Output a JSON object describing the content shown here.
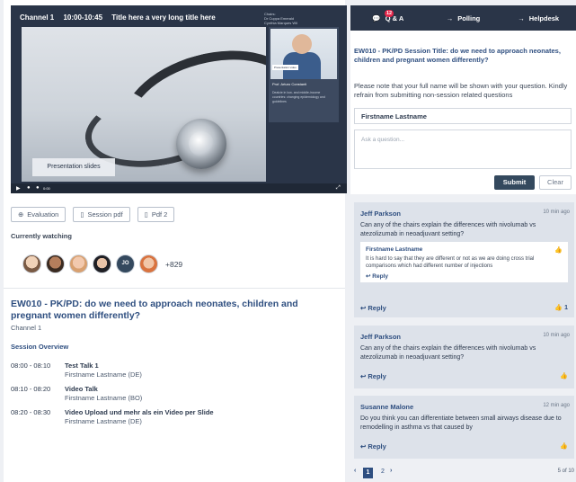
{
  "player": {
    "channel": "Channel 1",
    "time": "10:00-10:45",
    "title": "Title here a very long title here",
    "chairs": [
      "Chairs:",
      "Dr Cuppa Emerald",
      "Cynthia Marques Wil"
    ],
    "slide_label": "Presentation slides",
    "pip_chip": "Presentation video",
    "pip_name": "Prof. Arturo Constanti",
    "pip_text": "Dealcie in low- and middle-income countries: changing epidemiology and guidelines",
    "control_time": "0:00"
  },
  "tools": {
    "evaluation": "Evaluation",
    "session_pdf": "Session pdf",
    "pdf2": "Pdf 2"
  },
  "watching": {
    "label": "Currently watching",
    "initials": "JO",
    "count": "+829"
  },
  "session": {
    "title": "EW010 - PK/PD: do we need to approach neonates, children and pregnant women differently?",
    "channel": "Channel 1",
    "overview_label": "Session Overview",
    "talks": [
      {
        "time": "08:00 - 08:10",
        "title": "Test Talk 1",
        "speaker": "Firstname Lastname (DE)"
      },
      {
        "time": "08:10 - 08:20",
        "title": "Video Talk",
        "speaker": "Firstname Lastname (BO)"
      },
      {
        "time": "08:20 - 08:30",
        "title": "Video Upload und mehr als ein Video per Slide",
        "speaker": "Firstname Lastname (DE)"
      }
    ]
  },
  "tabs": {
    "qa": "Q & A",
    "qa_badge": "12",
    "polling": "Polling",
    "helpdesk": "Helpdesk"
  },
  "qa": {
    "title": "EW010 - PK/PD Session Title: do we need to approach neonates, children and pregnant women differently?",
    "note": "Please note that your full name will be shown with your question. Kindly refrain from submitting non-session related questions",
    "name_value": "Firstname Lastname",
    "placeholder": "Ask a question...",
    "submit": "Submit",
    "clear": "Clear"
  },
  "questions": [
    {
      "user": "Jeff Parkson",
      "time": "10 min ago",
      "text": "Can any of the chairs explain the differences with nivolumab vs atezolizumab in neoadjuvant setting?",
      "reply": "Reply",
      "likes": "1",
      "answer": {
        "user": "Firstname Lastname",
        "text": "It is hard to say that they are different or not as we are doing cross trial comparisons which had different number of injections",
        "reply": "Reply"
      }
    },
    {
      "user": "Jeff Parkson",
      "time": "10 min ago",
      "text": "Can any of the chairs explain the differences with nivolumab vs atezolizumab in neoadjuvant setting?",
      "reply": "Reply"
    },
    {
      "user": "Susanne Malone",
      "time": "12 min ago",
      "text": "Do you think you can differentiate between small airways disease due to remodelling in asthma vs that caused by",
      "reply": "Reply"
    }
  ],
  "pager": {
    "page1": "1",
    "page2": "2",
    "summary": "5 of 10"
  }
}
